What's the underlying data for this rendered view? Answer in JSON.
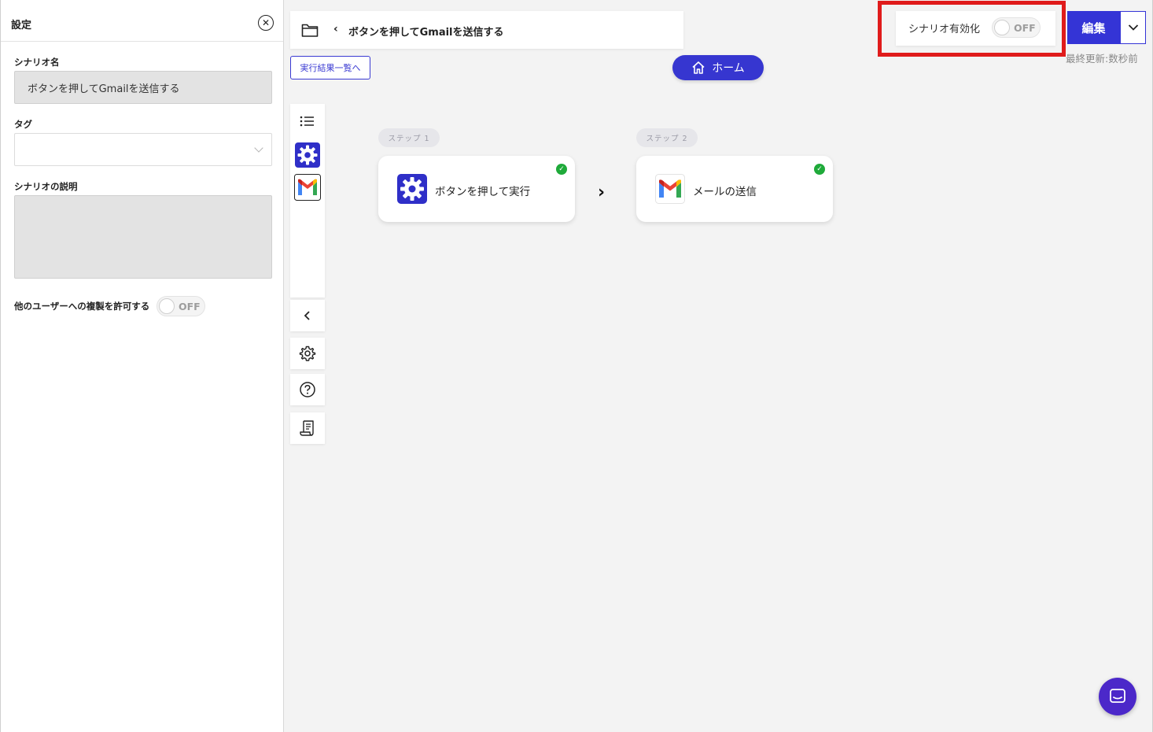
{
  "settings": {
    "title": "設定",
    "scenario_name_label": "シナリオ名",
    "scenario_name_value": "ボタンを押してGmailを送信する",
    "tag_label": "タグ",
    "description_label": "シナリオの説明",
    "copy_permission_label": "他のユーザーへの複製を許可する",
    "copy_permission_toggle": "OFF"
  },
  "header": {
    "title": "ボタンを押してGmailを送信する",
    "results_button": "実行結果一覧へ",
    "home_button": "ホーム",
    "activation_label": "シナリオ有効化",
    "activation_toggle": "OFF",
    "edit_button": "編集",
    "last_updated": "最終更新:数秒前"
  },
  "steps": [
    {
      "tag": "ステップ 1",
      "label": "ボタンを押して実行",
      "icon": "gear-icon",
      "status": "complete"
    },
    {
      "tag": "ステップ 2",
      "label": "メールの送信",
      "icon": "gmail-icon",
      "status": "complete"
    }
  ],
  "colors": {
    "accent": "#3636d0",
    "highlight": "#e01b1b",
    "success": "#1faa3a",
    "chat": "#4b28c9"
  }
}
